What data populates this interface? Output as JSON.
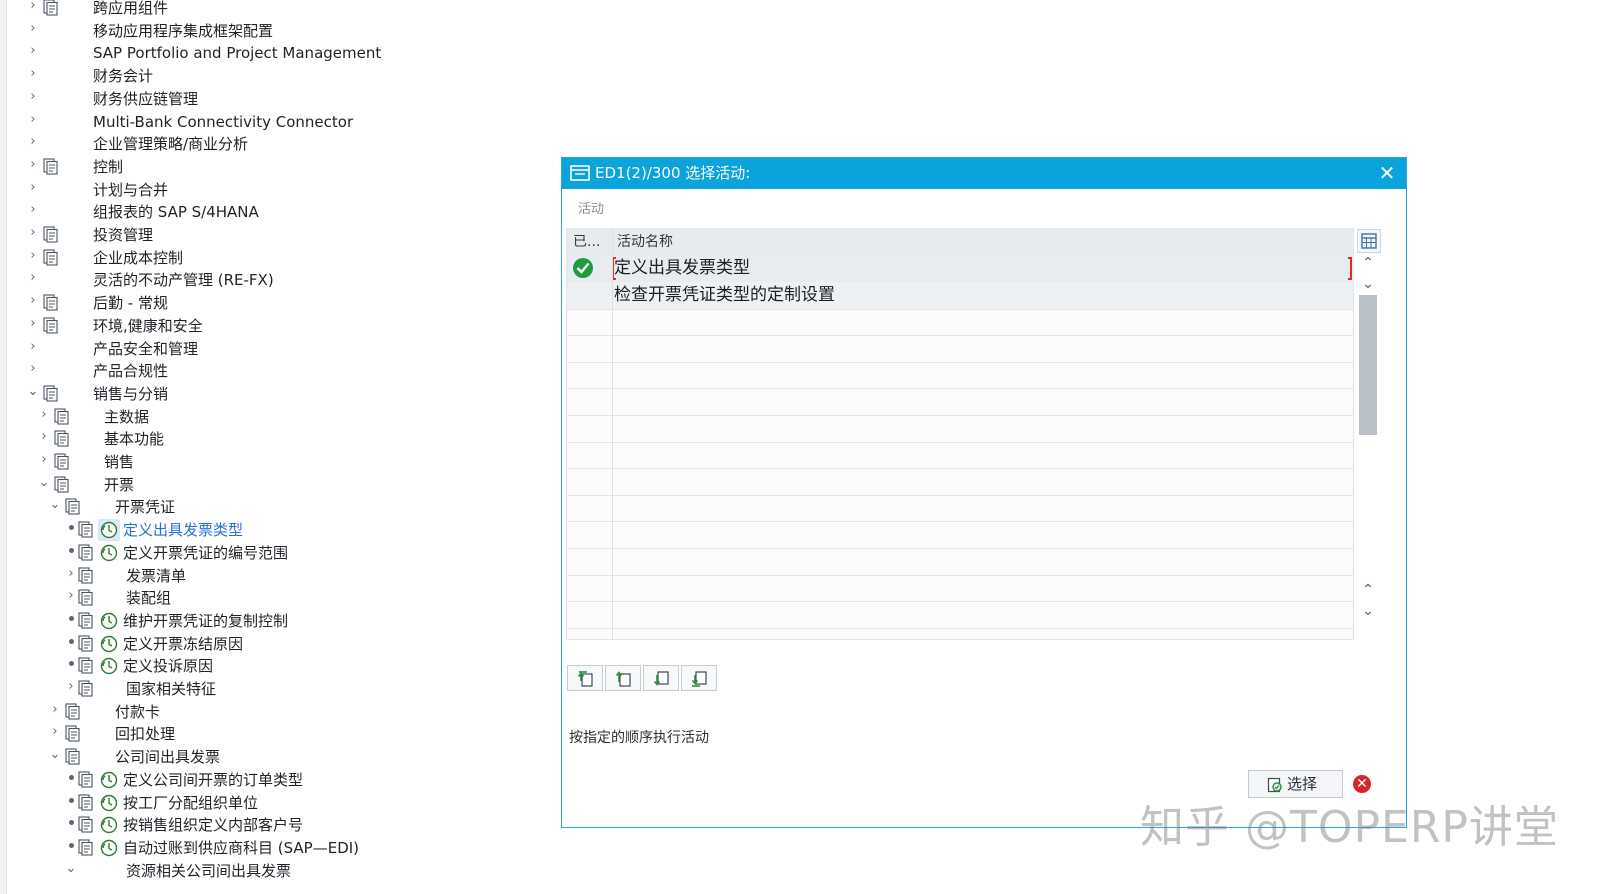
{
  "tree": {
    "items": [
      {
        "label": "跨应用组件",
        "arrow": "›",
        "doc": true,
        "clock": false
      },
      {
        "label": "移动应用程序集成框架配置",
        "arrow": "›",
        "doc": false,
        "clock": false
      },
      {
        "label": "SAP Portfolio and Project Management",
        "arrow": "›",
        "doc": false,
        "clock": false
      },
      {
        "label": "财务会计",
        "arrow": "›",
        "doc": false,
        "clock": false
      },
      {
        "label": "财务供应链管理",
        "arrow": "›",
        "doc": false,
        "clock": false
      },
      {
        "label": "Multi-Bank Connectivity Connector",
        "arrow": "›",
        "doc": false,
        "clock": false
      },
      {
        "label": "企业管理策略/商业分析",
        "arrow": "›",
        "doc": false,
        "clock": false
      },
      {
        "label": "控制",
        "arrow": "›",
        "doc": true,
        "clock": false
      },
      {
        "label": "计划与合并",
        "arrow": "›",
        "doc": false,
        "clock": false
      },
      {
        "label": "组报表的 SAP S/4HANA",
        "arrow": "›",
        "doc": false,
        "clock": false
      },
      {
        "label": "投资管理",
        "arrow": "›",
        "doc": true,
        "clock": false
      },
      {
        "label": "企业成本控制",
        "arrow": "›",
        "doc": true,
        "clock": false
      },
      {
        "label": "灵活的不动产管理 (RE-FX)",
        "arrow": "›",
        "doc": false,
        "clock": false
      },
      {
        "label": "后勤 - 常规",
        "arrow": "›",
        "doc": true,
        "clock": false
      },
      {
        "label": "环境,健康和安全",
        "arrow": "›",
        "doc": true,
        "clock": false
      },
      {
        "label": "产品安全和管理",
        "arrow": "›",
        "doc": false,
        "clock": false
      },
      {
        "label": "产品合规性",
        "arrow": "›",
        "doc": false,
        "clock": false
      },
      {
        "label": "销售与分销",
        "arrow": "⌄",
        "doc": true,
        "clock": false
      },
      {
        "label": "主数据",
        "arrow": "›",
        "doc": true,
        "clock": false
      },
      {
        "label": "基本功能",
        "arrow": "›",
        "doc": true,
        "clock": false
      },
      {
        "label": "销售",
        "arrow": "›",
        "doc": true,
        "clock": false
      },
      {
        "label": "开票",
        "arrow": "⌄",
        "doc": true,
        "clock": false
      },
      {
        "label": "开票凭证",
        "arrow": "⌄",
        "doc": true,
        "clock": false
      },
      {
        "label": "定义出具发票类型",
        "arrow": "•",
        "doc": true,
        "clock": true,
        "selected": true
      },
      {
        "label": "定义开票凭证的编号范围",
        "arrow": "•",
        "doc": true,
        "clock": true
      },
      {
        "label": "发票清单",
        "arrow": "›",
        "doc": true,
        "clock": false
      },
      {
        "label": "装配组",
        "arrow": "›",
        "doc": true,
        "clock": false
      },
      {
        "label": "维护开票凭证的复制控制",
        "arrow": "•",
        "doc": true,
        "clock": true
      },
      {
        "label": "定义开票冻结原因",
        "arrow": "•",
        "doc": true,
        "clock": true
      },
      {
        "label": "定义投诉原因",
        "arrow": "•",
        "doc": true,
        "clock": true
      },
      {
        "label": "国家相关特征",
        "arrow": "›",
        "doc": true,
        "clock": false
      },
      {
        "label": "付款卡",
        "arrow": "›",
        "doc": true,
        "clock": false
      },
      {
        "label": "回扣处理",
        "arrow": "›",
        "doc": true,
        "clock": false
      },
      {
        "label": "公司间出具发票",
        "arrow": "⌄",
        "doc": true,
        "clock": false
      },
      {
        "label": "定义公司间开票的订单类型",
        "arrow": "•",
        "doc": true,
        "clock": true
      },
      {
        "label": "按工厂分配组织单位",
        "arrow": "•",
        "doc": true,
        "clock": true
      },
      {
        "label": "按销售组织定义内部客户号",
        "arrow": "•",
        "doc": true,
        "clock": true
      },
      {
        "label": "自动过账到供应商科目 (SAP—EDI)",
        "arrow": "•",
        "doc": true,
        "clock": true
      },
      {
        "label": "资源相关公司间出具发票",
        "arrow": "⌄",
        "doc": false,
        "clock": false
      }
    ]
  },
  "dialog": {
    "title": "ED1(2)/300 选择活动:",
    "close_symbol": "✕",
    "section_label": "活动",
    "table": {
      "headers": [
        "已...",
        "活动名称"
      ],
      "rows": [
        {
          "done": true,
          "name": "定义出具发票类型"
        },
        {
          "done": false,
          "name": "检查开票凭证类型的定制设置"
        }
      ],
      "empty_rows": 12
    },
    "toolbar_icons": [
      "move-top-icon",
      "move-up-icon",
      "move-down-icon",
      "move-bottom-icon"
    ],
    "hint": "按指定的顺序执行活动",
    "select_label": "选择",
    "cancel_symbol": "✕"
  },
  "watermark": "知乎 @TOPERP讲堂",
  "colors": {
    "dialog_header": "#0aa3dc",
    "check_green": "#1e9d3a",
    "cancel_red": "#d7262b",
    "link_blue": "#2a6fd6"
  }
}
